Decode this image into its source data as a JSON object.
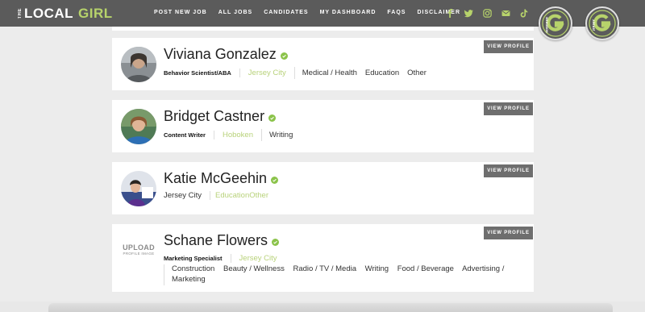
{
  "brand": {
    "the": "THE",
    "local": "LOCAL",
    "girl": "GIRL"
  },
  "nav": [
    "POST NEW JOB",
    "ALL JOBS",
    "CANDIDATES",
    "MY DASHBOARD",
    "FAQS",
    "DISCLAIMER"
  ],
  "social_icons": [
    "facebook-icon",
    "twitter-icon",
    "instagram-icon",
    "email-icon",
    "tiktok-icon"
  ],
  "badges": [
    "hoboken-girl-badge",
    "jersey-girl-badge"
  ],
  "view_profile_label": "VIEW PROFILE",
  "candidates": [
    {
      "name": "Viviana Gonzalez",
      "title": "Behavior Scientist/ABA",
      "city": "Jersey City",
      "tags": [
        "Medical / Health",
        "Education",
        "Other"
      ]
    },
    {
      "name": "Bridget Castner",
      "title": "Content Writer",
      "city": "Hoboken",
      "tags": [
        "Writing"
      ]
    },
    {
      "name": "Katie McGeehin",
      "location": "Jersey City",
      "tags_joined": "EducationOther"
    },
    {
      "name": "Schane Flowers",
      "title": "Marketing Specialist",
      "city": "Jersey City",
      "upload_text": "UPLOAD",
      "upload_sub": "PROFILE IMAGE",
      "tags": [
        "Construction",
        "Beauty / Wellness",
        "Radio / TV / Media",
        "Writing",
        "Food / Beverage",
        "Advertising /",
        "Marketing"
      ]
    }
  ],
  "colors": {
    "header": "#5b5b5b",
    "accent": "#b7d36b",
    "button": "#6e6e6e",
    "verified": "#8bc34a"
  }
}
